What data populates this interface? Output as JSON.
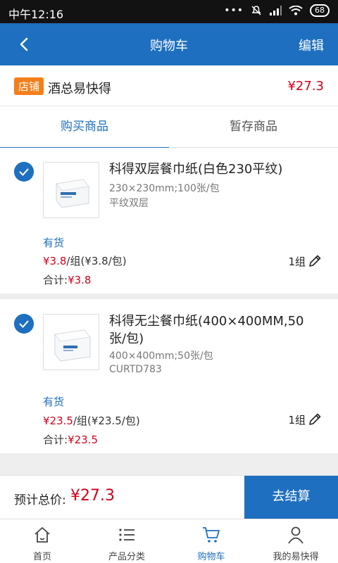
{
  "status_bar": {
    "time": "中午12:16",
    "battery": "68"
  },
  "header": {
    "title": "购物车",
    "edit_label": "编辑"
  },
  "shop": {
    "tag": "店铺",
    "name": "酒总易快得",
    "total": "¥27.3"
  },
  "tabs": [
    {
      "label": "购买商品",
      "active": true
    },
    {
      "label": "暂存商品",
      "active": false
    }
  ],
  "items": [
    {
      "name": "科得双层餐巾纸(白色230平纹)",
      "spec": "230×230mm;100张/包",
      "code": "平纹双层",
      "stock": "有货",
      "price": "¥3.8",
      "unit_price": "/组(¥3.8/包)",
      "subtotal_label": "合计:",
      "subtotal": "¥3.8",
      "qty": "1组"
    },
    {
      "name": "科得无尘餐巾纸(400×400MM,50张/包)",
      "spec": "400×400mm;50张/包",
      "code": "CURTD783",
      "stock": "有货",
      "price": "¥23.5",
      "unit_price": "/组(¥23.5/包)",
      "subtotal_label": "合计:",
      "subtotal": "¥23.5",
      "qty": "1组"
    }
  ],
  "checkout": {
    "label": "预计总价:",
    "amount": "¥27.3",
    "button": "去结算"
  },
  "bottom_nav": [
    {
      "label": "首页",
      "icon": "home-icon"
    },
    {
      "label": "产品分类",
      "icon": "list-icon"
    },
    {
      "label": "购物车",
      "icon": "cart-icon",
      "active": true
    },
    {
      "label": "我的易快得",
      "icon": "user-icon"
    }
  ],
  "colors": {
    "primary": "#1e6fbf",
    "price_red": "#d0021b",
    "shop_tag": "#f27f1b"
  }
}
